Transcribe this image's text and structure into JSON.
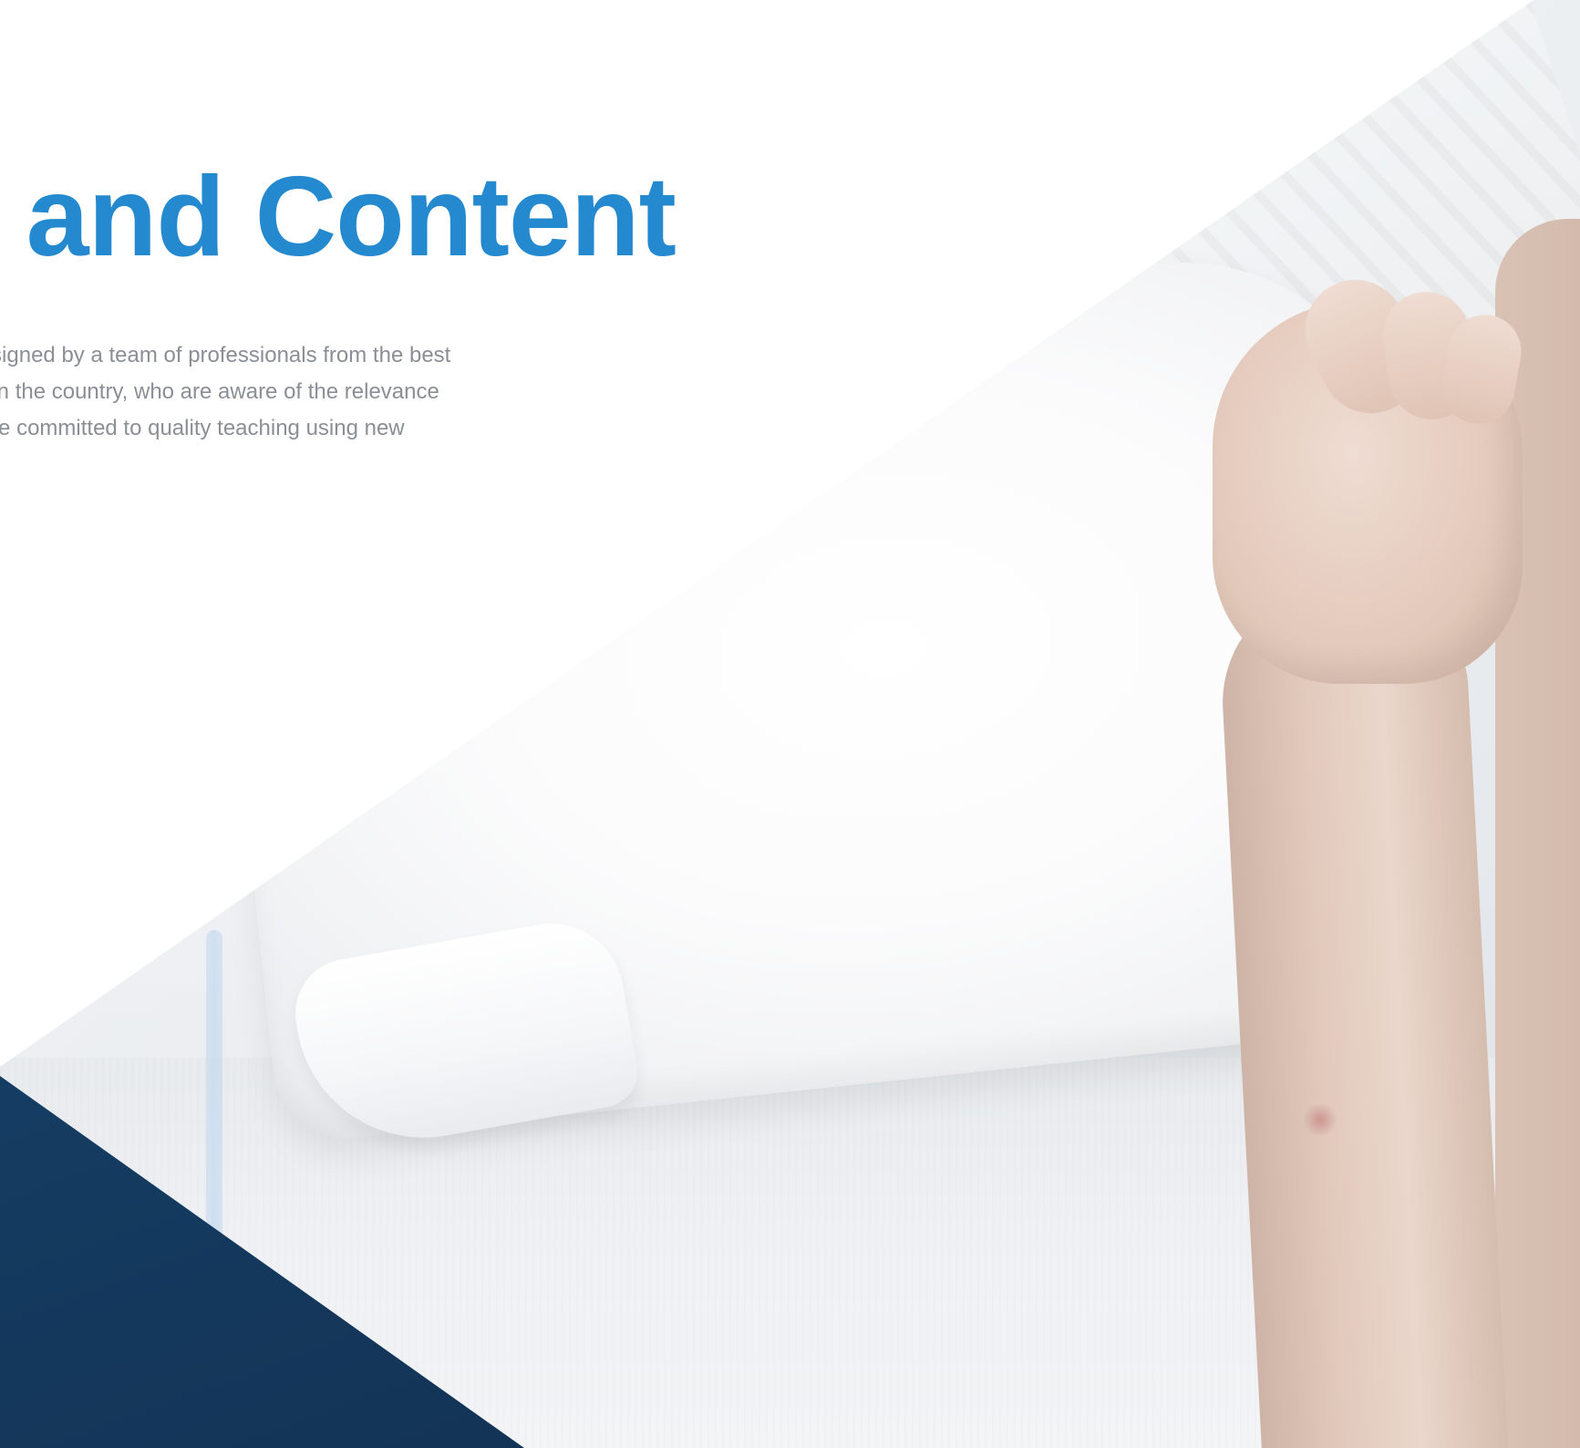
{
  "headline": "re and Content",
  "description": {
    "lines": [
      "en designed by a team of professionals from the best",
      "sities in the country, who are aware of the relevance",
      "and are committed to quality teaching using new"
    ]
  },
  "colors": {
    "headline": "#2589cf",
    "body_text": "#8a8f96",
    "corner_accent": "#163f66",
    "background": "#ffffff"
  }
}
